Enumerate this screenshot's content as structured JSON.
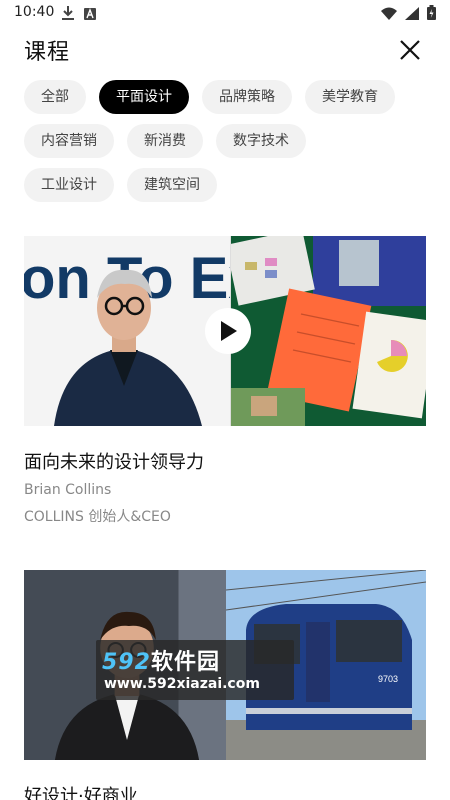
{
  "status": {
    "time": "10:40",
    "left_icons": [
      "download-icon",
      "notification-a-icon"
    ],
    "right_icons": [
      "wifi-icon",
      "signal-icon",
      "battery-icon"
    ]
  },
  "header": {
    "title": "课程",
    "close_icon": "close-icon"
  },
  "filters": {
    "rows": [
      [
        "全部",
        "平面设计",
        "品牌策略",
        "美学教育"
      ],
      [
        "内容营销",
        "新消费",
        "数字技术"
      ],
      [
        "工业设计",
        "建筑空间"
      ]
    ],
    "selected": "平面设计"
  },
  "courses": [
    {
      "title": "面向未来的设计领导力",
      "author": "Brian Collins",
      "role": "COLLINS 创始人&CEO",
      "has_play_button": true,
      "poster_text": "on To Ex"
    },
    {
      "title": "好设计·好商业",
      "poster_text": "9703"
    }
  ],
  "watermark": {
    "brand_num": "592",
    "brand_cn": "软件园",
    "url": "www.592xiazai.com"
  },
  "colors": {
    "chip_active_bg": "#000000",
    "chip_bg": "#f2f2f2",
    "meta_text": "#888888",
    "watermark_accent": "#4fc3f7"
  }
}
